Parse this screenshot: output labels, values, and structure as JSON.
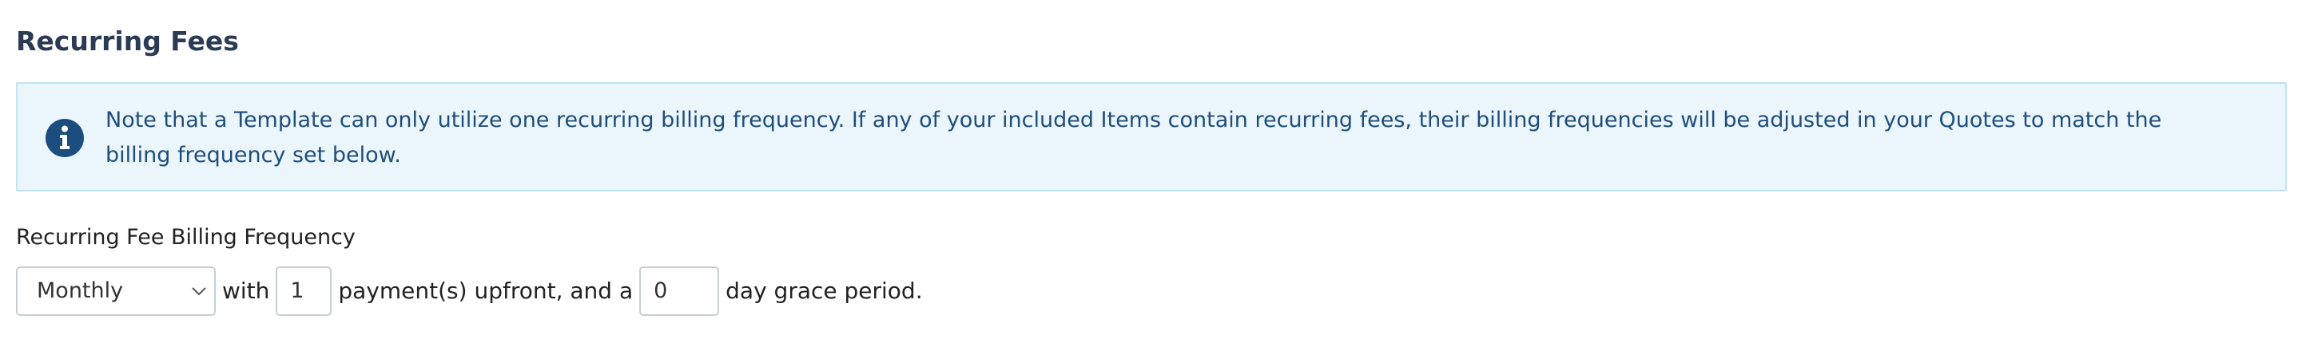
{
  "section": {
    "title": "Recurring Fees"
  },
  "notice": {
    "icon": "info-circle-icon",
    "text": "Note that a Template can only utilize one recurring billing frequency. If any of your included Items contain recurring fees, their billing frequencies will be adjusted in your Quotes to match the billing frequency set below."
  },
  "billing": {
    "label": "Recurring Fee Billing Frequency",
    "frequency_selected": "Monthly",
    "text_with": "with",
    "payments_upfront_value": "1",
    "text_payments": "payment(s) upfront, and a",
    "grace_period_value": "0",
    "text_grace": "day grace period."
  },
  "colors": {
    "title": "#2b3a55",
    "notice_background": "#eaf5fc",
    "notice_border": "#c3e3f3",
    "notice_text": "#1f4e7a",
    "icon": "#1b4d7e"
  }
}
